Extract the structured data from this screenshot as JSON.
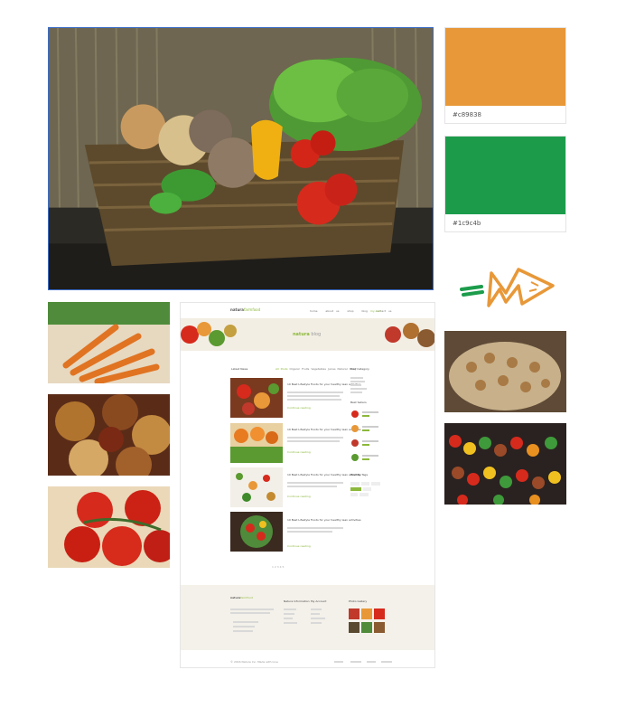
{
  "swatches": [
    {
      "hex": "#c89838",
      "color": "#e89838"
    },
    {
      "hex": "#1c9c4b",
      "color": "#1c9c4b"
    }
  ],
  "logo_icon": "carrot-m-logo",
  "mockup": {
    "brand_strong": "natura",
    "brand_light": "farmfood",
    "nav": [
      "home",
      "about us",
      "shop",
      "blog",
      "contact us"
    ],
    "cart": "my cart",
    "blog_title_strong": "natura",
    "blog_title_light": " blog",
    "latest_news": "Latest News",
    "filters": [
      "All Posts",
      "Organic",
      "Fruits",
      "Vegetables",
      "Juices",
      "Natural",
      "Dairy"
    ],
    "post_title": "10 Best Lifestyle Foods for your healthy lean activities",
    "read_more": "Continue reading",
    "sidebar_category": "Post Category",
    "sidebar_bestsellers": "Best Sellers",
    "sidebar_tags": "Best By Tags",
    "footer_info": "Natura Information",
    "footer_account": "My Account",
    "footer_gallery": "Photo Gallery",
    "copyright": "© 2016 Natura Inc. Made with love",
    "pagination": "1  2  3  4  5"
  }
}
